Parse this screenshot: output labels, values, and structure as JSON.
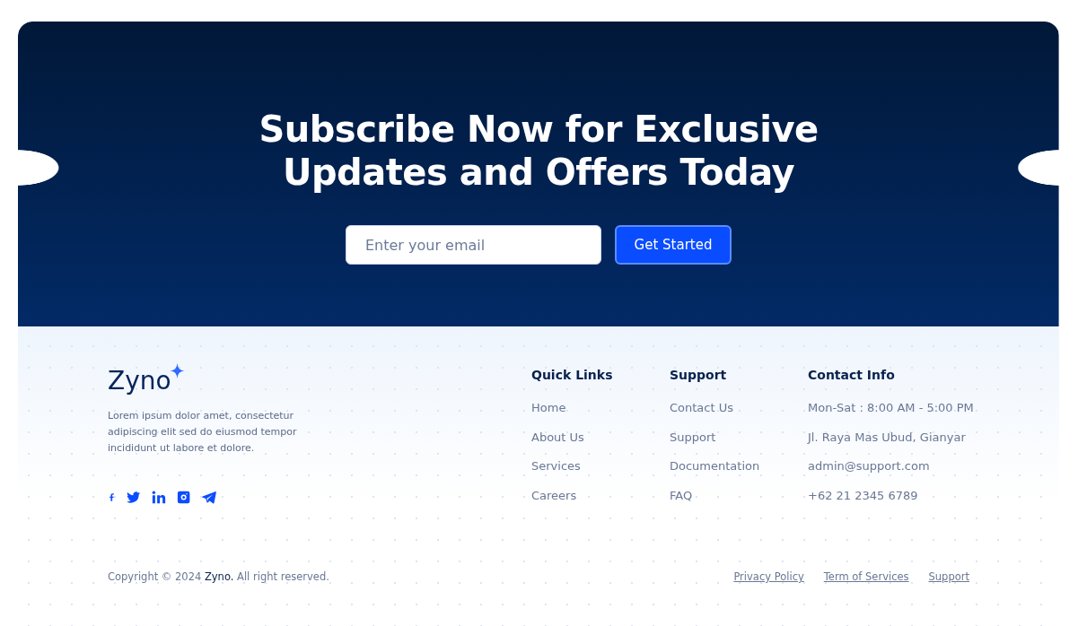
{
  "newsletter": {
    "title": "Subscribe Now for Exclusive Updates and Offers Today",
    "email_field": {
      "placeholder": "Enter your email"
    },
    "button": "Get Started"
  },
  "footer": {
    "brand": {
      "name": "Zyno",
      "description": "Lorem ipsum dolor amet, consectetur adipiscing elit sed do eiusmod tempor incididunt ut labore et dolore."
    },
    "social": [
      {
        "kind": "facebook"
      },
      {
        "kind": "twitter"
      },
      {
        "kind": "linkedin"
      },
      {
        "kind": "instagram"
      },
      {
        "kind": "telegram"
      }
    ],
    "columns": [
      {
        "title": "Quick Links",
        "items": [
          "Home",
          "About Us",
          "Services",
          "Careers"
        ]
      },
      {
        "title": "Support",
        "items": [
          "Contact Us",
          "Support",
          "Documentation",
          "FAQ"
        ]
      },
      {
        "title": "Contact Info",
        "items": [
          "Mon-Sat : 8:00 AM - 5:00 PM",
          "Jl. Raya Mas Ubud, Gianyar",
          "admin@support.com",
          "+62 21 2345 6789"
        ]
      }
    ],
    "copyright": "Copyright © 2024 **Zyno.** All right reserved.",
    "legal_links": [
      "Privacy Policy",
      "Term of Services",
      "Support"
    ]
  }
}
